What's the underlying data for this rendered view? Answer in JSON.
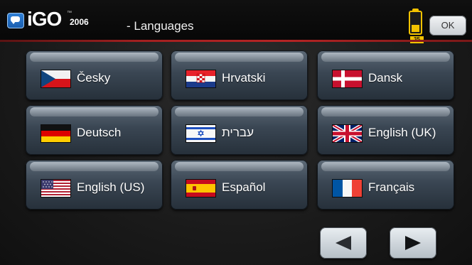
{
  "header": {
    "logo": "iGO",
    "logo_tm": "™",
    "logo_year": "2006",
    "title": "- Languages",
    "battery_level": "35",
    "ok_label": "OK"
  },
  "languages": [
    {
      "label": "Česky",
      "flag": "czech-flag-icon"
    },
    {
      "label": "Hrvatski",
      "flag": "croatian-flag-icon"
    },
    {
      "label": "Dansk",
      "flag": "danish-flag-icon"
    },
    {
      "label": "Deutsch",
      "flag": "german-flag-icon"
    },
    {
      "label": "עברית",
      "flag": "israeli-flag-icon"
    },
    {
      "label": "English (UK)",
      "flag": "uk-flag-icon"
    },
    {
      "label": "English (US)",
      "flag": "us-flag-icon"
    },
    {
      "label": "Español",
      "flag": "spanish-flag-icon"
    },
    {
      "label": "Français",
      "flag": "french-flag-icon"
    }
  ],
  "nav": {
    "prev_icon": "left-arrow-icon",
    "next_icon": "right-arrow-icon",
    "prev_enabled": false,
    "next_enabled": true
  },
  "colors": {
    "accent_line": "#b52424",
    "battery": "#f2c200",
    "button_face": "#3a4653"
  }
}
